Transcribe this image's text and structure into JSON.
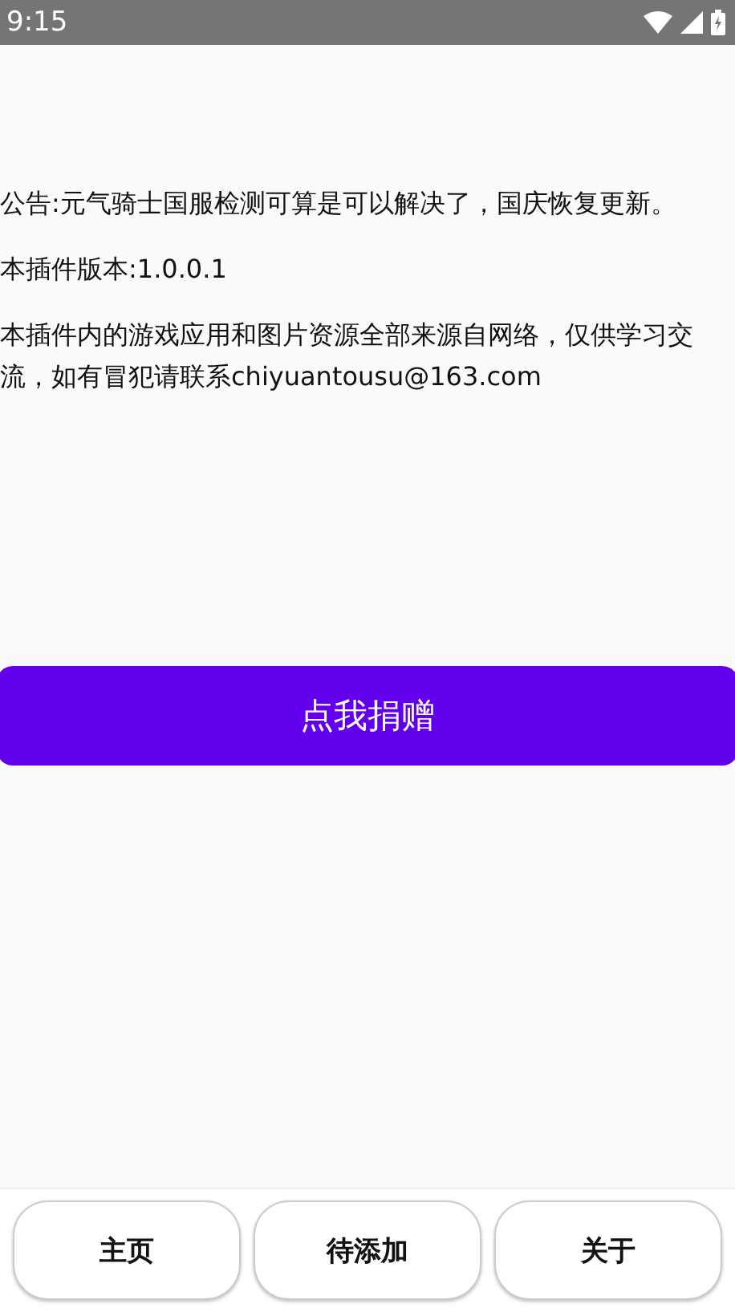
{
  "status_bar": {
    "time": "9:15"
  },
  "paragraphs": [
    "公告:元气骑士国服检测可算是可以解决了，国庆恢复更新。",
    "本插件版本:1.0.0.1",
    "本插件内的游戏应用和图片资源全部来源自网络，仅供学习交流，如有冒犯请联系chiyuantousu@163.com"
  ],
  "donate_button": "点我捐赠",
  "nav": [
    {
      "label": "主页"
    },
    {
      "label": "待添加"
    },
    {
      "label": "关于"
    }
  ]
}
